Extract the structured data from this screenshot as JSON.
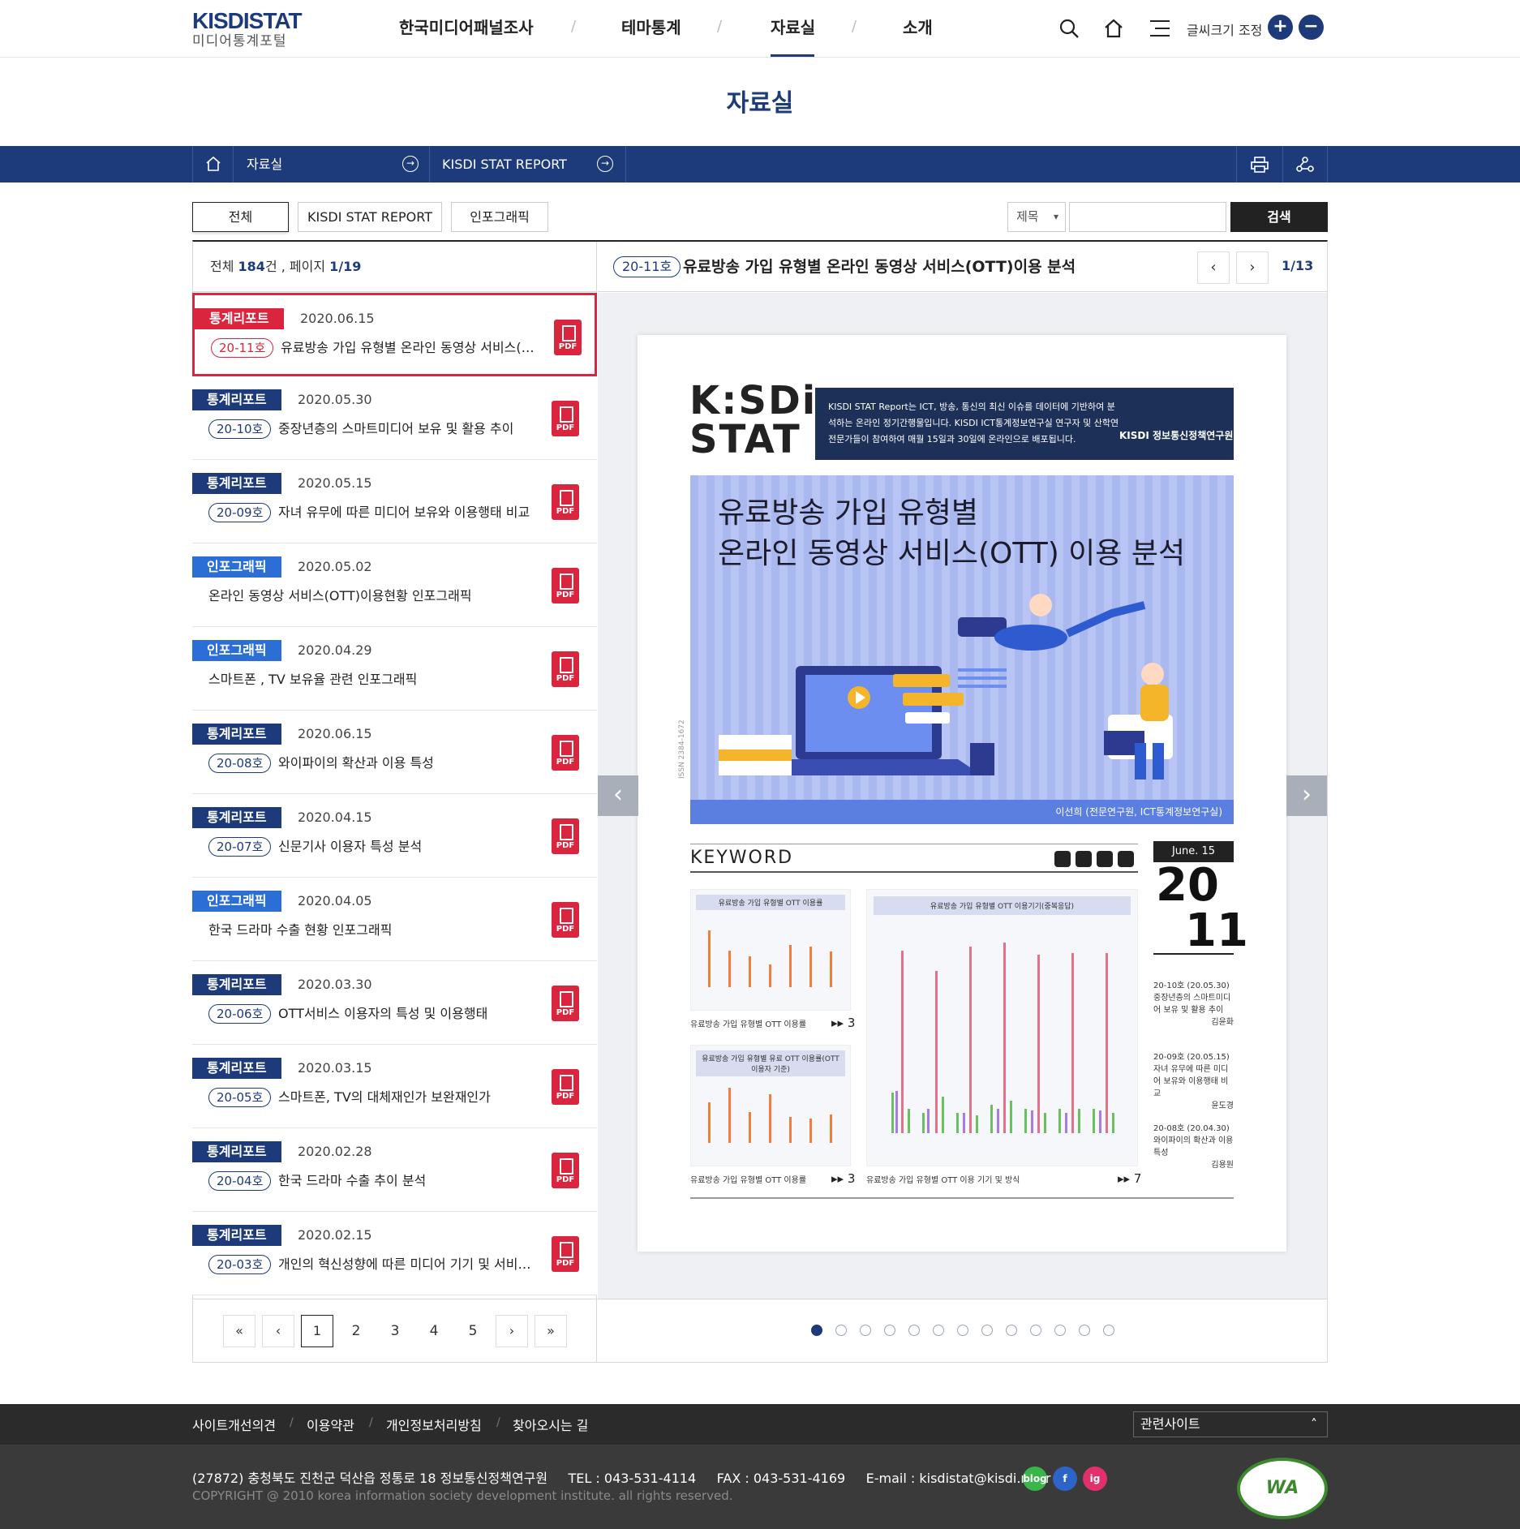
{
  "header": {
    "logo_main": "KISDISTAT",
    "logo_sub": "미디어통계포털",
    "nav": [
      "한국미디어패널조사",
      "테마통계",
      "자료실",
      "소개"
    ],
    "font_size_label": "글씨크기 조정",
    "font_plus": "+",
    "font_minus": "−"
  },
  "page_title": "자료실",
  "breadcrumb": {
    "level1": "자료실",
    "level2": "KISDI STAT REPORT"
  },
  "filter": {
    "tabs": [
      "전체",
      "KISDI STAT REPORT",
      "인포그래픽"
    ],
    "select_value": "제목",
    "search_button": "검색"
  },
  "list": {
    "summary_prefix": "전체 ",
    "total": "184",
    "summary_mid": "건 , 페이지 ",
    "page": "1",
    "summary_slash": "/",
    "pages": "19",
    "items": [
      {
        "cat": "통계리포트",
        "date": "2020.06.15",
        "num": "20-11호",
        "title": "유료방송 가입 유형별 온라인 동영상 서비스(…",
        "pdf": "PDF"
      },
      {
        "cat": "통계리포트",
        "date": "2020.05.30",
        "num": "20-10호",
        "title": "중장년층의 스마트미디어 보유 및 활용 추이",
        "pdf": "PDF"
      },
      {
        "cat": "통계리포트",
        "date": "2020.05.15",
        "num": "20-09호",
        "title": "자녀 유무에 따른 미디어 보유와 이용행태 비교",
        "pdf": "PDF"
      },
      {
        "cat": "인포그래픽",
        "date": "2020.05.02",
        "num": "",
        "title": "온라인 동영상 서비스(OTT)이용현황 인포그래픽",
        "pdf": "PDF"
      },
      {
        "cat": "인포그래픽",
        "date": "2020.04.29",
        "num": "",
        "title": "스마트폰 , TV 보유율 관련 인포그래픽",
        "pdf": "PDF"
      },
      {
        "cat": "통계리포트",
        "date": "2020.06.15",
        "num": "20-08호",
        "title": "와이파이의 확산과 이용 특성",
        "pdf": "PDF"
      },
      {
        "cat": "통계리포트",
        "date": "2020.04.15",
        "num": "20-07호",
        "title": "신문기사 이용자 특성 분석",
        "pdf": "PDF"
      },
      {
        "cat": "인포그래픽",
        "date": "2020.04.05",
        "num": "",
        "title": "한국 드라마 수출 현황 인포그래픽",
        "pdf": "PDF"
      },
      {
        "cat": "통계리포트",
        "date": "2020.03.30",
        "num": "20-06호",
        "title": "OTT서비스 이용자의 특성 및 이용행태",
        "pdf": "PDF"
      },
      {
        "cat": "통계리포트",
        "date": "2020.03.15",
        "num": "20-05호",
        "title": "스마트폰, TV의 대체재인가 보완재인가",
        "pdf": "PDF"
      },
      {
        "cat": "통계리포트",
        "date": "2020.02.28",
        "num": "20-04호",
        "title": "한국 드라마 수출 추이 분석",
        "pdf": "PDF"
      },
      {
        "cat": "통계리포트",
        "date": "2020.02.15",
        "num": "20-03호",
        "title": "개인의 혁신성향에 따른 미디어 기기 및 서비…",
        "pdf": "PDF"
      }
    ]
  },
  "pagination": {
    "first": "«",
    "prev": "‹",
    "pages": [
      "1",
      "2",
      "3",
      "4",
      "5"
    ],
    "next": "›",
    "last": "»"
  },
  "viewer": {
    "num": "20-11호",
    "title": "유료방송 가입 유형별 온라인 동영상 서비스(OTT)이용 분석",
    "prev": "‹",
    "next": "›",
    "page_current": "1",
    "page_slash": "/",
    "page_total": "13",
    "slide_prev": "‹",
    "slide_next": "›",
    "dots": 13,
    "active_dot": 0
  },
  "document": {
    "logo_line1": "K:SDi",
    "logo_line2": "STAT",
    "intro": "KISDI STAT Report는 ICT, 방송, 통신의 최신 이슈를 데이터에 기반하여 분석하는 온라인 정기간행물입니다. KISDI ICT통계정보연구실 연구자 및 산학연 전문가들이 참여하여 매월 15일과 30일에 온라인으로 배포됩니다.",
    "kisdi_label": "KISDI 정보통신정책연구원",
    "hero_title_1": "유료방송 가입 유형별",
    "hero_title_2": "온라인 동영상 서비스(OTT) 이용 분석",
    "author": "이선희 (전문연구원, ICT통계정보연구실)",
    "issn": "ISSN 2384-1672",
    "keyword": "KEYWORD",
    "date_box": "June. 15",
    "issue_top": "20",
    "issue_bottom": "11",
    "chart1_head": "유료방송 가입 유형별 OTT 이용률",
    "chart1_cap": "유료방송 가입 유형별 OTT 이용률",
    "chart1_page": "3",
    "chart2_head": "유료방송 가입 유형별 유료 OTT 이용률(OTT 이용자 기준)",
    "chart2_cap": "유료방송 가입 유형별 OTT 이용률",
    "chart2_page": "3",
    "chart3_head": "유료방송 가입 유형별 OTT 이용기기(중복응답)",
    "chart3_cap": "유료방송 가입 유형별 OTT 이용 기기 및 방식",
    "chart3_page": "7",
    "side": [
      {
        "num": "20-10호 (20.05.30)",
        "title": "중장년층의 스마트미디어 보유 및 활용 추이",
        "author": "김윤화"
      },
      {
        "num": "20-09호 (20.05.15)",
        "title": "자녀 유무에 따른 미디어 보유와 이용행태 비교",
        "author": "윤도경"
      },
      {
        "num": "20-08호 (20.04.30)",
        "title": "와이파이의 확산과 이용 특성",
        "author": "김용원"
      }
    ]
  },
  "footer": {
    "links": [
      "사이트개선의견",
      "이용약관",
      "개인정보처리방침",
      "찾아오시는 길"
    ],
    "related": "관련사이트",
    "address": "(27872) 충청북도 진천군 덕산읍 정통로 18 정보통신정책연구원     TEL : 043-531-4114     FAX : 043-531-4169     E-mail : kisdistat@kisdi.re.kr",
    "copyright": "COPYRIGHT @ 2010 korea information society development institute. all rights reserved.",
    "sns": [
      "blog",
      "f",
      "ig"
    ],
    "wa": "WA"
  },
  "colors": {
    "brand": "#1d3a7a",
    "accent": "#d9263e",
    "info": "#2b6fd6"
  }
}
